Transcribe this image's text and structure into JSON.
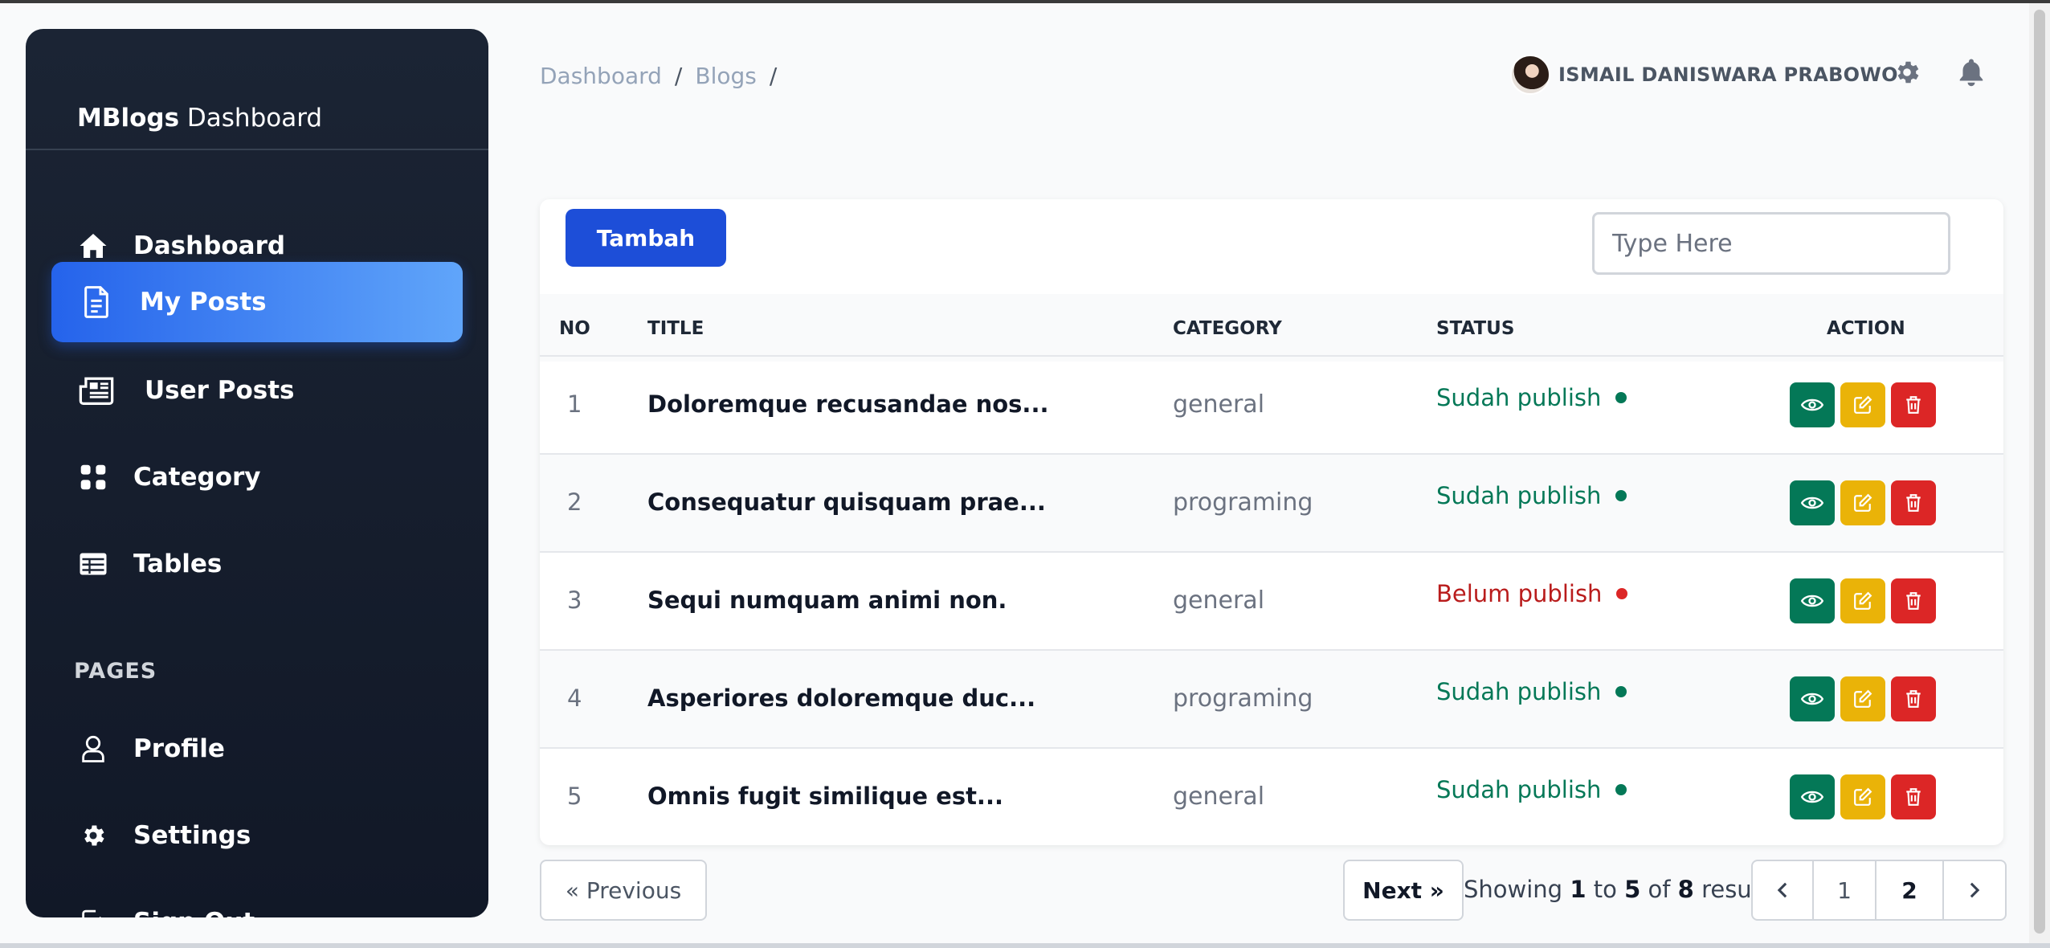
{
  "sidebar": {
    "brand_bold": "MBlogs",
    "brand_rest": " Dashboard",
    "items": [
      {
        "label": "Dashboard",
        "icon": "home-icon"
      },
      {
        "label": "My Posts",
        "icon": "document-icon"
      },
      {
        "label": "User Posts",
        "icon": "newspaper-icon"
      },
      {
        "label": "Category",
        "icon": "grid-icon"
      },
      {
        "label": "Tables",
        "icon": "table-icon"
      }
    ],
    "pages_title": "PAGES",
    "pages": [
      {
        "label": "Profile",
        "icon": "user-icon"
      },
      {
        "label": "Settings",
        "icon": "gear-icon"
      },
      {
        "label": "Sign Out",
        "icon": "sign-out-icon"
      }
    ]
  },
  "header": {
    "breadcrumb": [
      "Dashboard",
      "Blogs"
    ],
    "separator": "/",
    "username": "ISMAIL DANISWARA PRABOWO"
  },
  "toolbar": {
    "add_label": "Tambah",
    "search_placeholder": "Type Here"
  },
  "table": {
    "headers": {
      "no": "NO",
      "title": "TITLE",
      "category": "CATEGORY",
      "status": "STATUS",
      "action": "ACTION"
    },
    "rows": [
      {
        "no": "1",
        "title": "Doloremque recusandae nos...",
        "category": "general",
        "status": "Sudah publish"
      },
      {
        "no": "2",
        "title": "Consequatur quisquam prae...",
        "category": "programing",
        "status": "Sudah publish"
      },
      {
        "no": "3",
        "title": "Sequi numquam animi non.",
        "category": "general",
        "status": "Belum publish"
      },
      {
        "no": "4",
        "title": "Asperiores doloremque duc...",
        "category": "programing",
        "status": "Sudah publish"
      },
      {
        "no": "5",
        "title": "Omnis fugit similique est...",
        "category": "general",
        "status": "Sudah publish"
      }
    ]
  },
  "pagination": {
    "previous": "« Previous",
    "next": "Next »",
    "showing": "Showing",
    "from": "1",
    "to_word": "to",
    "to": "5",
    "of_word": "of",
    "total": "8",
    "results": "results",
    "pages": [
      "1",
      "2"
    ]
  },
  "colors": {
    "accent": "#2563eb",
    "published": "#047857",
    "unpublished": "#dc2626",
    "edit": "#eab308",
    "sidebar": "#111827"
  }
}
